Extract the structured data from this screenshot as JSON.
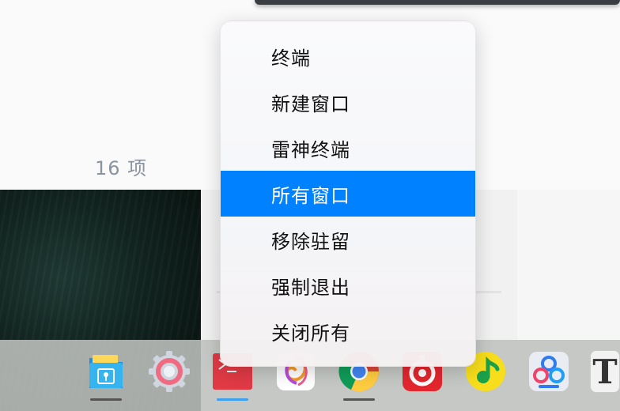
{
  "file_panel": {
    "item_count": "16 项"
  },
  "context_menu": {
    "items": [
      {
        "label": "终端",
        "active": false
      },
      {
        "label": "新建窗口",
        "active": false
      },
      {
        "label": "雷神终端",
        "active": false
      },
      {
        "label": "所有窗口",
        "active": true
      },
      {
        "label": "移除驻留",
        "active": false
      },
      {
        "label": "强制退出",
        "active": false
      },
      {
        "label": "关闭所有",
        "active": false
      }
    ],
    "highlight_color": "#0081ff"
  },
  "dock": {
    "apps": [
      {
        "name": "file-manager-icon",
        "running": true
      },
      {
        "name": "settings-icon",
        "running": false
      },
      {
        "name": "terminal-icon",
        "running": true
      },
      {
        "name": "draw-icon",
        "running": false
      },
      {
        "name": "chrome-icon",
        "running": true
      },
      {
        "name": "music-red-icon",
        "running": false
      },
      {
        "name": "qq-music-icon",
        "running": false
      },
      {
        "name": "baidu-netdisk-icon",
        "running": false
      },
      {
        "name": "font-viewer-icon",
        "running": false
      }
    ],
    "font_viewer_glyph": "T"
  }
}
